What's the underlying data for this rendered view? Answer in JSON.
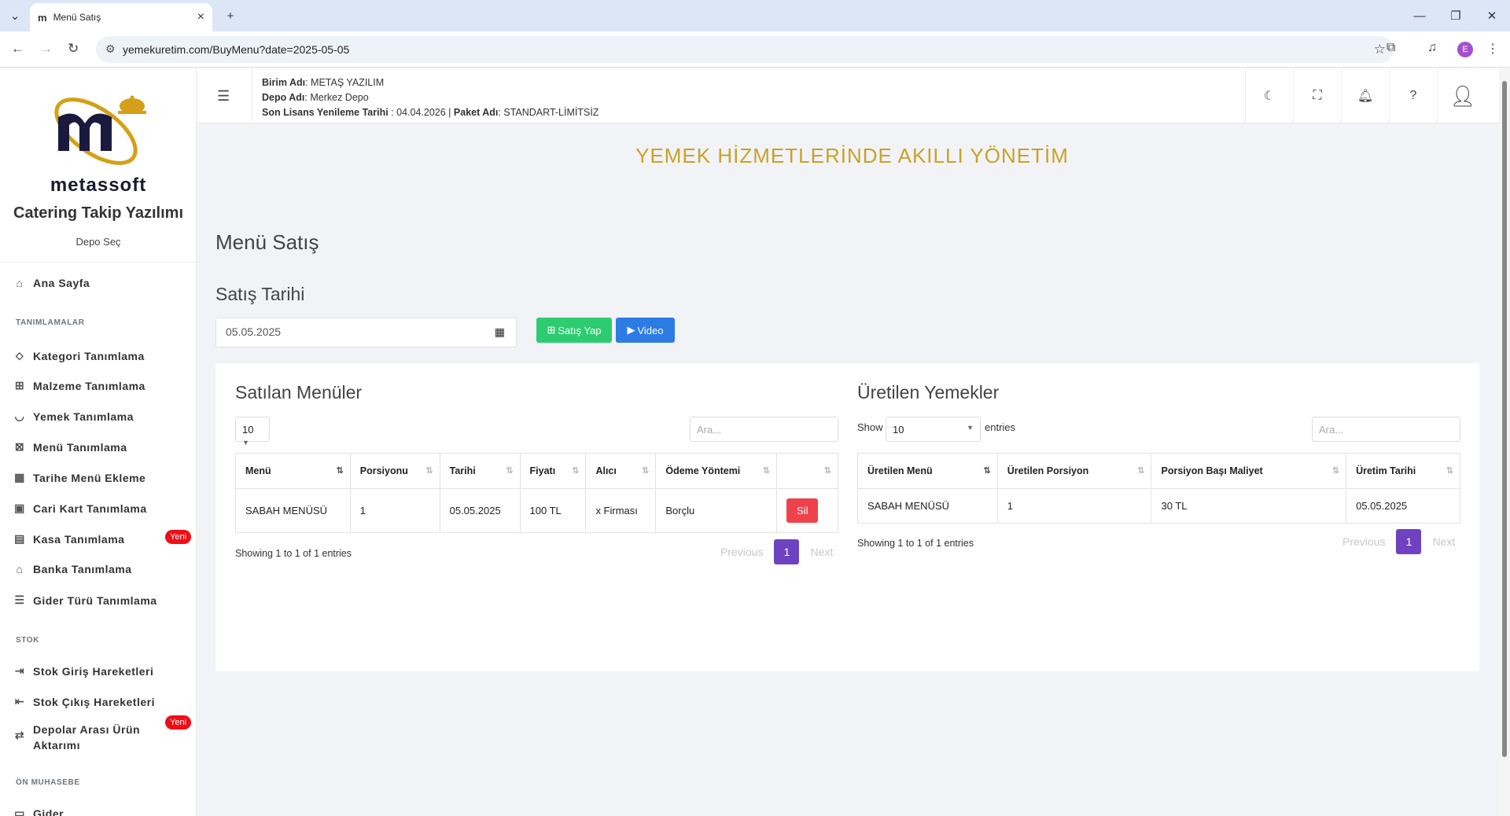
{
  "browser": {
    "tab_title": "Menü Satış",
    "tab_favicon": "m",
    "url": "yemekuretim.com/BuyMenu?date=2025-05-05",
    "profile_initial": "E"
  },
  "sidebar": {
    "logo_text": "metassoft",
    "subtitle": "Catering Takip Yazılımı",
    "depo_sec": "Depo Seç",
    "home": "Ana Sayfa",
    "sections": {
      "tanimlamalar": "TANIMLAMALAR",
      "stok": "STOK",
      "on_muhasebe": "ÖN MUHASEBE"
    },
    "items": {
      "kategori": "Kategori Tanımlama",
      "malzeme": "Malzeme Tanımlama",
      "yemek": "Yemek Tanımlama",
      "menu": "Menü Tanımlama",
      "tarihe_menu": "Tarihe Menü Ekleme",
      "cari": "Cari Kart Tanımlama",
      "kasa": "Kasa Tanımlama",
      "banka": "Banka Tanımlama",
      "gider_turu": "Gider Türü Tanımlama",
      "stok_giris": "Stok Giriş Hareketleri",
      "stok_cikis": "Stok Çıkış Hareketleri",
      "depolar_1": "Depolar Arası Ürün",
      "depolar_2": "Aktarımı",
      "gider": "Gider"
    },
    "badge_new": "Yeni"
  },
  "topbar": {
    "birim_label": "Birim Adı",
    "birim_value": ": METAŞ YAZILIM",
    "depo_label": "Depo Adı",
    "depo_value": ": Merkez Depo",
    "lisans_label": "Son Lisans Yenileme Tarihi",
    "lisans_value": " : 04.04.2026 | ",
    "paket_label": "Paket Adı",
    "paket_value": ": STANDART-LİMİTSİZ"
  },
  "hero": "YEMEK HİZMETLERİNDE AKILLI YÖNETİM",
  "page_title": "Menü Satış",
  "satis_tarihi_label": "Satış Tarihi",
  "date_value": "05.05.2025",
  "buttons": {
    "satis_yap": "Satış Yap",
    "video": "Video",
    "sil": "Sil"
  },
  "satilan": {
    "title": "Satılan Menüler",
    "length": "10",
    "search_placeholder": "Ara...",
    "columns": [
      "Menü",
      "Porsiyonu",
      "Tarihi",
      "Fiyatı",
      "Alıcı",
      "Ödeme Yöntemi"
    ],
    "row": [
      "SABAH MENÜSÜ",
      "1",
      "05.05.2025",
      "100 TL",
      "x Firması",
      "Borçlu"
    ],
    "info": "Showing 1 to 1 of 1 entries"
  },
  "uretilen": {
    "title": "Üretilen Yemekler",
    "show": "Show",
    "entries": "entries",
    "length": "10",
    "search_placeholder": "Ara...",
    "columns": [
      "Üretilen Menü",
      "Üretilen Porsiyon",
      "Porsiyon Başı Maliyet",
      "Üretim Tarihi"
    ],
    "row": [
      "SABAH MENÜSÜ",
      "1",
      "30 TL",
      "05.05.2025"
    ],
    "info": "Showing 1 to 1 of 1 entries"
  },
  "pagination": {
    "previous": "Previous",
    "page": "1",
    "next": "Next"
  }
}
